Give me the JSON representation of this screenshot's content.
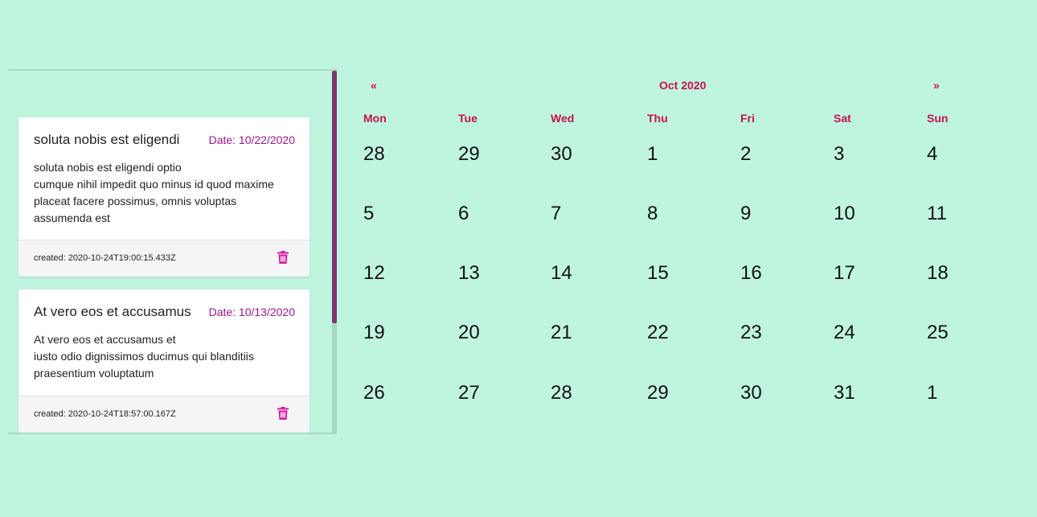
{
  "events": [
    {
      "title": "soluta nobis est eligendi",
      "date": "Date: 10/22/2020",
      "lines": [
        "soluta nobis est eligendi optio",
        "cumque nihil impedit quo minus id quod maxime",
        "placeat facere possimus, omnis voluptas",
        "assumenda est"
      ],
      "created": "created: 2020-10-24T19:00:15.433Z",
      "delete_icon": "trash-icon"
    },
    {
      "title": "At vero eos et accusamus",
      "date": "Date: 10/13/2020",
      "lines": [
        "At vero eos et accusamus et",
        "iusto odio dignissimos ducimus qui blanditiis",
        "praesentium voluptatum"
      ],
      "created": "created: 2020-10-24T18:57:00.167Z",
      "delete_icon": "trash-icon"
    }
  ],
  "calendar": {
    "prev": "«",
    "next": "»",
    "title": "Oct 2020",
    "weekdays": [
      "Mon",
      "Tue",
      "Wed",
      "Thu",
      "Fri",
      "Sat",
      "Sun"
    ],
    "weeks": [
      [
        "28",
        "29",
        "30",
        "1",
        "2",
        "3",
        "4"
      ],
      [
        "5",
        "6",
        "7",
        "8",
        "9",
        "10",
        "11"
      ],
      [
        "12",
        "13",
        "14",
        "15",
        "16",
        "17",
        "18"
      ],
      [
        "19",
        "20",
        "21",
        "22",
        "23",
        "24",
        "25"
      ],
      [
        "26",
        "27",
        "28",
        "29",
        "30",
        "31",
        "1"
      ]
    ]
  },
  "colors": {
    "background": "#bff5de",
    "accent": "#c8104e",
    "date_text": "#a0168a",
    "scrollbar": "#7a3a6e"
  }
}
